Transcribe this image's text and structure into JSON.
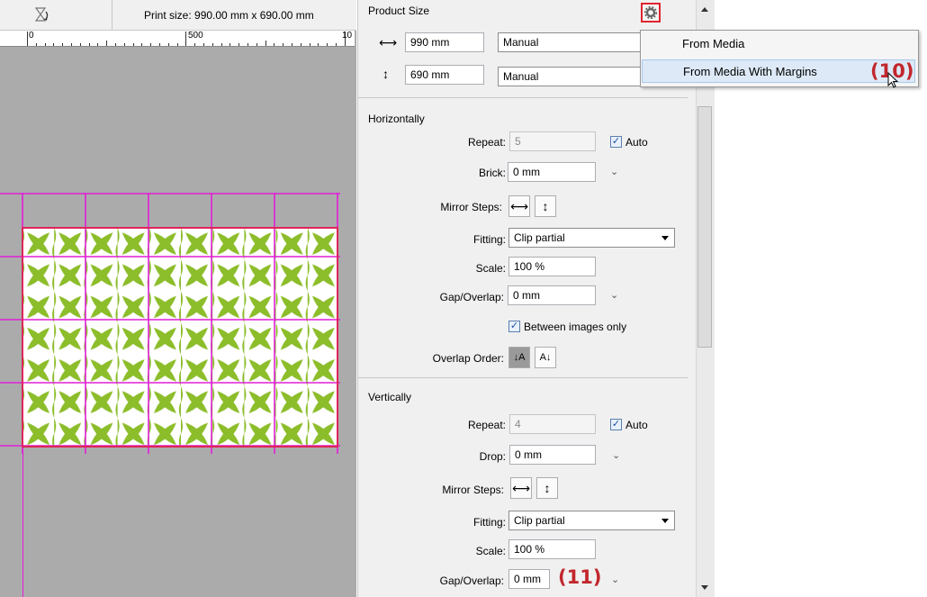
{
  "header": {
    "print_size": "Print size: 990.00 mm x 690.00 mm",
    "ruler_labels": [
      "0",
      "500",
      "10"
    ]
  },
  "product_size": {
    "title": "Product Size",
    "width_value": "990 mm",
    "width_mode": "Manual",
    "height_value": "690 mm",
    "height_mode": "Manual"
  },
  "menu": {
    "items": [
      "From Media",
      "From Media With Margins"
    ]
  },
  "horizontally": {
    "title": "Horizontally",
    "repeat_label": "Repeat:",
    "repeat_value": "5",
    "auto_label": "Auto",
    "brick_label": "Brick:",
    "brick_value": "0 mm",
    "mirror_label": "Mirror Steps:",
    "fitting_label": "Fitting:",
    "fitting_value": "Clip partial",
    "scale_label": "Scale:",
    "scale_value": "100 %",
    "gap_label": "Gap/Overlap:",
    "gap_value": "0 mm",
    "between_label": "Between images only",
    "overlap_label": "Overlap Order:"
  },
  "vertically": {
    "title": "Vertically",
    "repeat_label": "Repeat:",
    "repeat_value": "4",
    "auto_label": "Auto",
    "drop_label": "Drop:",
    "drop_value": "0 mm",
    "mirror_label": "Mirror Steps:",
    "fitting_label": "Fitting:",
    "fitting_value": "Clip partial",
    "scale_label": "Scale:",
    "scale_value": "100 %",
    "gap_label": "Gap/Overlap:",
    "gap_value": "0 mm"
  },
  "annotations": {
    "callout_10": "(10)",
    "callout_11": "(11)"
  },
  "colors": {
    "pattern_green": "#8cbd2a",
    "grid_magenta": "#e01fd7",
    "print_outline": "#e0245a",
    "callout_red": "#c1272d"
  },
  "icons": {
    "rotate": "rotate-icon",
    "gear": "gear-icon",
    "width": "horizontal-arrow-icon",
    "height": "vertical-arrow-icon",
    "cursor": "mouse-cursor-icon"
  }
}
